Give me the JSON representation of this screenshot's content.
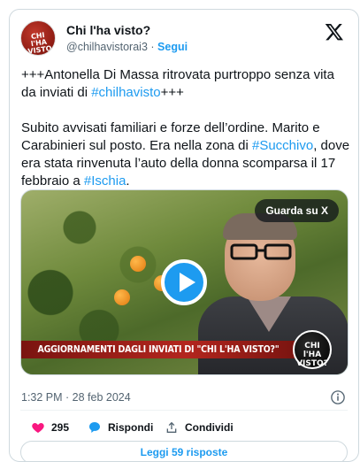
{
  "author": {
    "display_name": "Chi l'ha visto?",
    "handle": "@chilhavistorai3",
    "separator": "·",
    "follow_label": "Segui",
    "avatar_text": "CHI l'HA VISTO"
  },
  "tweet": {
    "paragraph1": {
      "before": "+++Antonella Di Massa ritrovata purtroppo senza vita da inviati di ",
      "hashtag": "#chilhavisto",
      "after": "+++"
    },
    "paragraph2": {
      "part1": "Subito avvisati familiari e forze dell’ordine. Marito e Carabinieri sul posto. Era nella zona di  ",
      "hashtag1": "#Succhivo",
      "part2": ", dove era stata rinvenuta l’auto della donna scomparsa il 17 febbraio  a ",
      "hashtag2": "#Ischia",
      "part3": "."
    }
  },
  "media": {
    "watch_label": "Guarda su X",
    "banner_text": "AGGIORNAMENTI DAGLI INVIATI DI \"CHI L'HA VISTO?\"",
    "logo_text": "CHI l'HA VISTO?"
  },
  "meta": {
    "timestamp": "1:32 PM · 28 feb 2024"
  },
  "actions": {
    "likes": "295",
    "reply_label": "Rispondi",
    "share_label": "Condividi"
  },
  "read_replies_label": "Leggi 59 risposte",
  "colors": {
    "accent": "#1d9bf0",
    "like": "#f91880",
    "text": "#0f1419",
    "secondary": "#536471"
  }
}
